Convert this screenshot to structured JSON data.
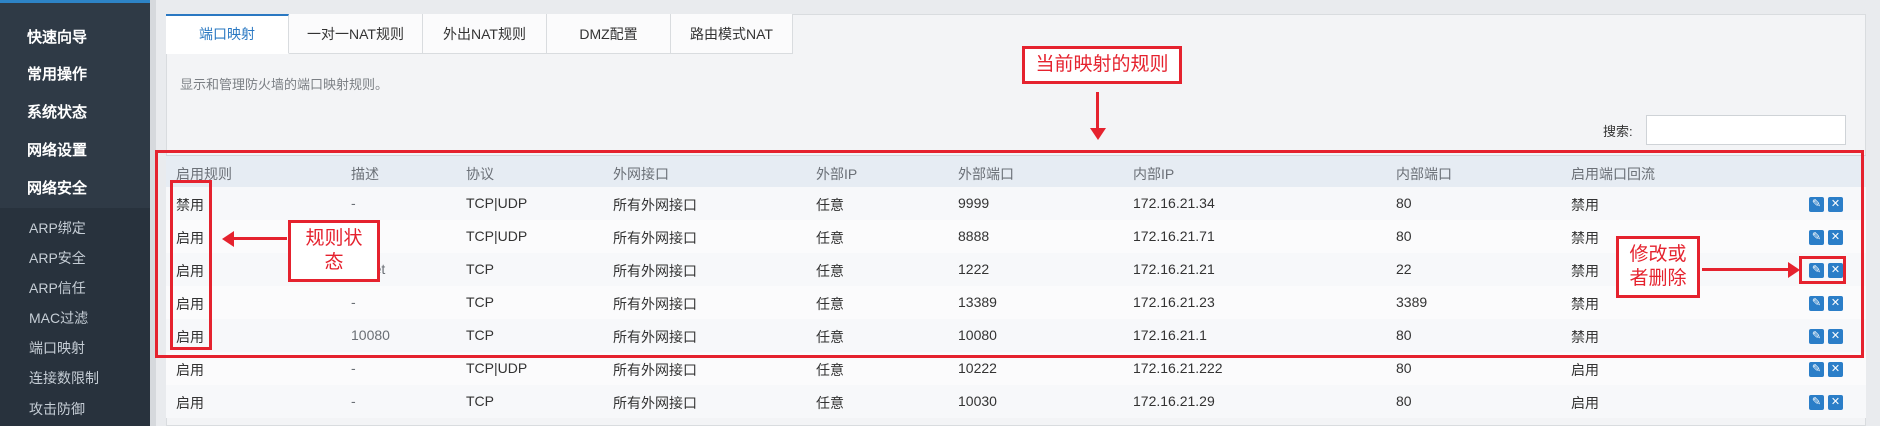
{
  "sidebar": {
    "main_items": [
      "快速向导",
      "常用操作",
      "系统状态",
      "网络设置",
      "网络安全"
    ],
    "sub_items": [
      "ARP绑定",
      "ARP安全",
      "ARP信任",
      "MAC过滤",
      "端口映射",
      "连接数限制",
      "攻击防御"
    ]
  },
  "tabs": [
    "端口映射",
    "一对一NAT规则",
    "外出NAT规则",
    "DMZ配置",
    "路由模式NAT"
  ],
  "active_tab": "端口映射",
  "description": "显示和管理防火墙的端口映射规则。",
  "search": {
    "label": "搜索:",
    "value": ""
  },
  "table": {
    "headers": [
      "启用规则",
      "描述",
      "协议",
      "外网接口",
      "外部IP",
      "外部端口",
      "内部IP",
      "内部端口",
      "启用端口回流"
    ],
    "rows": [
      [
        "禁用",
        "-",
        "TCP|UDP",
        "所有外网接口",
        "任意",
        "9999",
        "172.16.21.34",
        "80",
        "禁用"
      ],
      [
        "启用",
        "",
        "TCP|UDP",
        "所有外网接口",
        "任意",
        "8888",
        "172.16.21.71",
        "80",
        "禁用"
      ],
      [
        "启用",
        "telnet",
        "TCP",
        "所有外网接口",
        "任意",
        "1222",
        "172.16.21.21",
        "22",
        "禁用"
      ],
      [
        "启用",
        "-",
        "TCP",
        "所有外网接口",
        "任意",
        "13389",
        "172.16.21.23",
        "3389",
        "禁用"
      ],
      [
        "启用",
        "10080",
        "TCP",
        "所有外网接口",
        "任意",
        "10080",
        "172.16.21.1",
        "80",
        "禁用"
      ],
      [
        "启用",
        "-",
        "TCP|UDP",
        "所有外网接口",
        "任意",
        "10222",
        "172.16.21.222",
        "80",
        "启用"
      ],
      [
        "启用",
        "-",
        "TCP",
        "所有外网接口",
        "任意",
        "10030",
        "172.16.21.29",
        "80",
        "启用"
      ]
    ]
  },
  "annotations": {
    "current_rules": "当前映射的规则",
    "rule_status": "规则状态",
    "modify_delete_1": "修改或",
    "modify_delete_2": "者删除"
  },
  "icons": {
    "edit": "pencil-icon",
    "delete": "close-icon"
  },
  "colors": {
    "accent": "#2a78c2",
    "annotation": "#e5222e",
    "sidebar": "#2f3a46"
  }
}
